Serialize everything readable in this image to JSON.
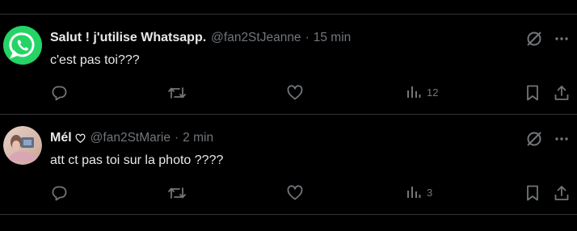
{
  "tweets": [
    {
      "name": "Salut ! j'utilise Whatsapp.",
      "handle": "@fan2StJeanne",
      "dot": "·",
      "time": "15 min",
      "text": "c'est pas toi???",
      "views": "12",
      "avatar_icon": "whatsapp-logo-icon"
    },
    {
      "name": "Mél",
      "handle": "@fan2StMarie",
      "dot": "·",
      "time": "2 min",
      "text": "att ct pas toi sur la photo ????",
      "views": "3",
      "avatar_icon": "profile-photo"
    }
  ],
  "colors": {
    "background": "#000000",
    "text_primary": "#e7e9ea",
    "text_secondary": "#71767b",
    "divider": "#2f3336",
    "whatsapp_green": "#25d366"
  }
}
